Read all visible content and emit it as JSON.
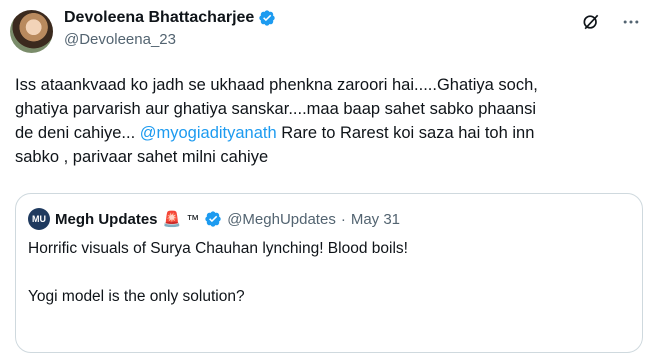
{
  "tweet": {
    "author_name": "Devoleena Bhattacharjee",
    "author_handle": "@Devoleena_23",
    "text_before": "Iss ataankvaad ko jadh se ukhaad phenkna zaroori hai.....Ghatiya soch,\nghatiya parvarish aur ghatiya sanskar....maa baap sahet sabko phaansi\nde deni cahiye... ",
    "mention": "@myogiadityanath",
    "text_after": " Rare to Rarest koi saza hai toh inn\nsabko , parivaar sahet milni cahiye"
  },
  "icons": {
    "verified": "verified-badge-icon",
    "grok": "grok-icon",
    "more": "more-options-icon",
    "siren": "siren-emoji"
  },
  "quote": {
    "avatar_text": "MU",
    "author_name": "Megh Updates",
    "siren": "🚨",
    "tm": "™",
    "author_handle": "@MeghUpdates",
    "dot": "·",
    "date": "May 31",
    "line1": "Horrific visuals of Surya Chauhan lynching! Blood boils!",
    "line2": "Yogi model is the only solution?"
  },
  "colors": {
    "accent": "#1d9bf0",
    "verified": "#1d9bf0",
    "secondary_text": "#536471",
    "border": "#cfd9de"
  }
}
